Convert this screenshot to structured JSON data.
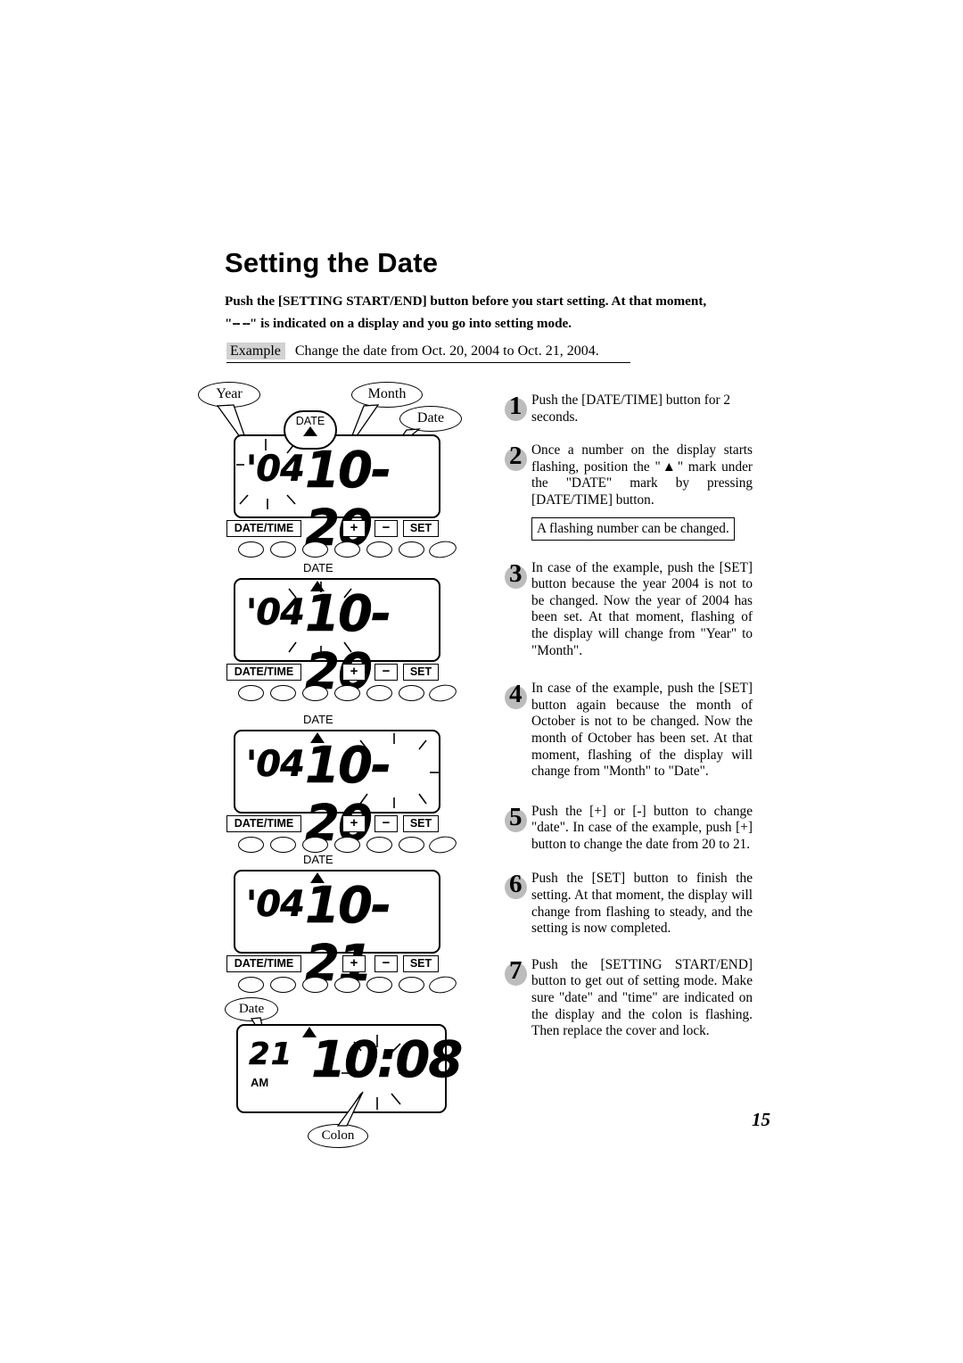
{
  "document": {
    "title": "Setting the Date",
    "page_number": "15",
    "lead_line1": "Push the [SETTING START/END] button before you start setting.  At that moment,",
    "lead_quote_open": "\"",
    "lead_dashes": "-- --",
    "lead_line2": "\" is indicated on a display and you go into setting mode.",
    "example_tag": "Example",
    "example_text": "Change the date from Oct. 20, 2004 to Oct. 21, 2004."
  },
  "callouts": {
    "year": "Year",
    "month": "Month",
    "date": "Date",
    "date_bottom": "Date",
    "colon": "Colon"
  },
  "displays": [
    {
      "id": "display-step1",
      "date_marker_label": "DATE",
      "marker_style": "oval",
      "year": "'04",
      "main": "10-20",
      "flashing": "year"
    },
    {
      "id": "display-step3",
      "date_marker_label": "DATE",
      "marker_style": "plain",
      "year": "'04",
      "main": "10-20",
      "flashing": "month"
    },
    {
      "id": "display-step4",
      "date_marker_label": "DATE",
      "marker_style": "plain",
      "year": "'04",
      "main": "10-20",
      "flashing": "date"
    },
    {
      "id": "display-step5",
      "date_marker_label": "DATE",
      "marker_style": "plain",
      "year": "'04",
      "main": "10-21",
      "flashing": "none"
    },
    {
      "id": "display-step7",
      "date_marker_label": "",
      "marker_style": "plain",
      "day": "21",
      "am_label": "AM",
      "time": "10:08",
      "flashing": "colon"
    }
  ],
  "buttons": {
    "date_time": "DATE/TIME",
    "plus": "+",
    "minus": "−",
    "set": "SET"
  },
  "steps": [
    {
      "number": "1",
      "text": "Push the [DATE/TIME] button for 2 seconds."
    },
    {
      "number": "2",
      "text": "Once a number on the display starts flashing, position the \"▲\" mark under the \"DATE\" mark by pressing [DATE/TIME] button.",
      "note": "A flashing number can be changed."
    },
    {
      "number": "3",
      "text": "In case of the example, push the [SET] button because the year 2004 is not to be changed.  Now the year of 2004 has been set.  At that moment, flashing of the display will change from \"Year\" to \"Month\"."
    },
    {
      "number": "4",
      "text": "In case of the example, push the [SET] button again because the month of October is not to be changed. Now the month of October has been set.  At that moment, flashing of the display will change from \"Month\" to \"Date\"."
    },
    {
      "number": "5",
      "text": "Push the [+] or [-] button to change \"date\".  In case of the example, push [+] button to change the date from 20 to 21."
    },
    {
      "number": "6",
      "text": "Push the [SET] button to finish the setting.  At that moment, the display will change from flashing to steady, and the setting is now completed."
    },
    {
      "number": "7",
      "text": "Push the [SETTING START/END] button to get out of setting mode. Make sure \"date\" and \"time\" are indicated on the display and the colon is flashing.  Then replace the cover and lock."
    }
  ]
}
